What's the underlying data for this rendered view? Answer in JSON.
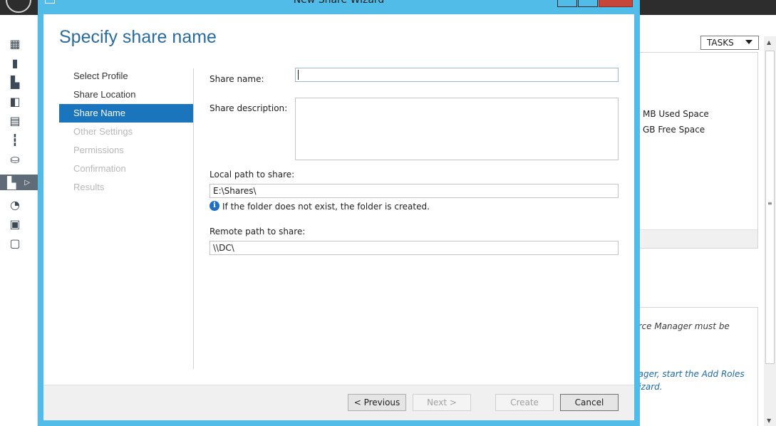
{
  "server_manager": {
    "tasks_label": "TASKS",
    "stats": [
      "MB Used Space",
      "GB Free Space"
    ],
    "notes": [
      {
        "text": "urce Manager must be",
        "link": false
      },
      {
        "text": "nager, start the Add Roles",
        "link": true
      },
      {
        "text": "Vizard.",
        "link": true
      }
    ]
  },
  "wizard": {
    "window_title": "New Share Wizard",
    "heading": "Specify share name",
    "steps": [
      {
        "label": "Select Profile",
        "state": "done"
      },
      {
        "label": "Share Location",
        "state": "done"
      },
      {
        "label": "Share Name",
        "state": "active"
      },
      {
        "label": "Other Settings",
        "state": "disabled"
      },
      {
        "label": "Permissions",
        "state": "disabled"
      },
      {
        "label": "Confirmation",
        "state": "disabled"
      },
      {
        "label": "Results",
        "state": "disabled"
      }
    ],
    "fields": {
      "share_name_label": "Share name:",
      "share_name_value": "",
      "share_description_label": "Share description:",
      "share_description_value": "",
      "local_path_label": "Local path to share:",
      "local_path_value": "E:\\Shares\\",
      "info_text": "If the folder does not exist, the folder is created.",
      "remote_path_label": "Remote path to share:",
      "remote_path_value": "\\\\DC\\"
    },
    "buttons": {
      "previous": "< Previous",
      "next": "Next >",
      "create": "Create",
      "cancel": "Cancel"
    }
  },
  "colors": {
    "window_frame": "#52bce8",
    "accent": "#1b75bc",
    "heading": "#2a6b9e"
  }
}
